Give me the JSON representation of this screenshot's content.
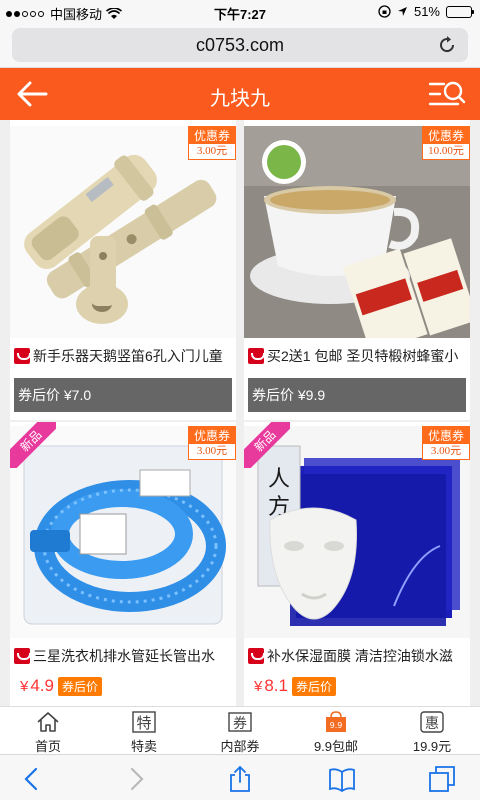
{
  "status_bar": {
    "carrier": "中国移动",
    "time": "下午7:27",
    "battery": "51%",
    "battery_level": 0.51
  },
  "browser": {
    "url": "c0753.com"
  },
  "header": {
    "title": "九块九"
  },
  "products": [
    {
      "name": "新手乐器天鹅竖笛6孔入门儿童",
      "coupon_label": "优惠券",
      "coupon_amount": "3.00元",
      "price_label": "券后价 ¥7.0"
    },
    {
      "name": "买2送1 包邮 圣贝特椴树蜂蜜小",
      "coupon_label": "优惠券",
      "coupon_amount": "10.00元",
      "price_label": "券后价 ¥9.9"
    },
    {
      "name": "三星洗衣机排水管延长管出水",
      "coupon_label": "优惠券",
      "coupon_amount": "3.00元",
      "badge": "新品",
      "price": "4.9",
      "price_tag": "券后价"
    },
    {
      "name": "补水保湿面膜 清洁控油锁水滋",
      "coupon_label": "优惠券",
      "coupon_amount": "3.00元",
      "badge": "新品",
      "price": "8.1",
      "price_tag": "券后价"
    }
  ],
  "currency": "¥",
  "tabs": [
    {
      "label": "首页",
      "icon": "home-icon"
    },
    {
      "label": "特卖",
      "icon": "sale-icon",
      "glyph": "特"
    },
    {
      "label": "内部券",
      "icon": "coupon-icon",
      "glyph": "券"
    },
    {
      "label": "9.9包邮",
      "icon": "bag-icon",
      "glyph": "9.9"
    },
    {
      "label": "19.9元",
      "icon": "discount-icon",
      "glyph": "惠"
    }
  ],
  "colors": {
    "accent": "#fb5a1e",
    "price_red": "#ff3333",
    "new_badge": "#e83a9c"
  }
}
